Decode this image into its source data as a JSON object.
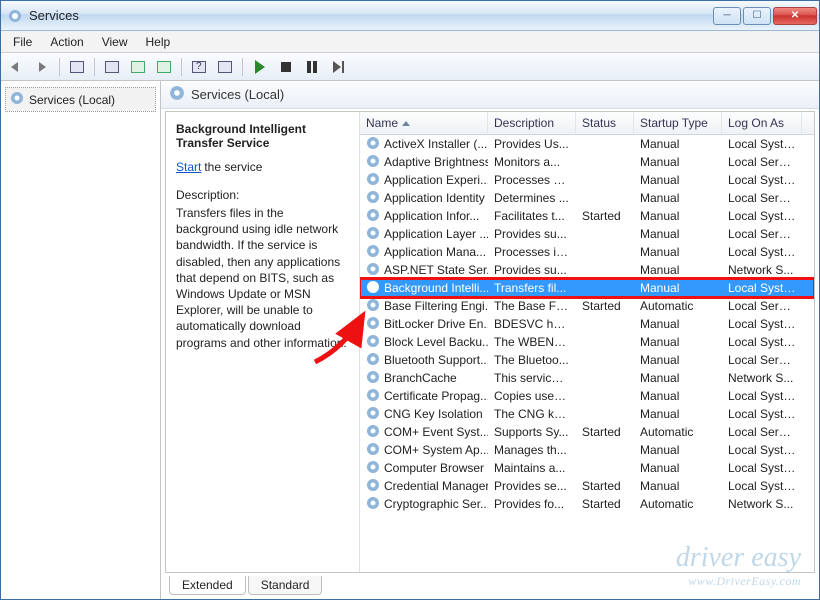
{
  "window": {
    "title": "Services"
  },
  "menubar": {
    "items": [
      "File",
      "Action",
      "View",
      "Help"
    ]
  },
  "toolbar": {
    "buttons": [
      {
        "name": "back-button",
        "icon": "arrow-left-icon"
      },
      {
        "name": "forward-button",
        "icon": "arrow-right-icon"
      },
      {
        "name": "show-hide-tree-button",
        "icon": "panel-icon"
      },
      {
        "name": "properties-button",
        "icon": "props-icon"
      },
      {
        "name": "refresh-button",
        "icon": "refresh-icon"
      },
      {
        "name": "export-list-button",
        "icon": "export-icon"
      },
      {
        "name": "help-button",
        "icon": "help-icon"
      },
      {
        "name": "grid-button",
        "icon": "grid-icon"
      },
      {
        "name": "start-service-button",
        "icon": "play-icon"
      },
      {
        "name": "stop-service-button",
        "icon": "stop-icon"
      },
      {
        "name": "pause-service-button",
        "icon": "pause-icon"
      },
      {
        "name": "restart-service-button",
        "icon": "restart-icon"
      }
    ]
  },
  "tree": {
    "selected_label": "Services (Local)"
  },
  "content_header": "Services (Local)",
  "detail": {
    "title": "Background Intelligent Transfer Service",
    "action_link": "Start",
    "action_text": "the service",
    "desc_label": "Description:",
    "desc_body": "Transfers files in the background using idle network bandwidth. If the service is disabled, then any applications that depend on BITS, such as Windows Update or MSN Explorer, will be unable to automatically download programs and other information."
  },
  "columns": [
    "Name",
    "Description",
    "Status",
    "Startup Type",
    "Log On As"
  ],
  "services": [
    {
      "name": "ActiveX Installer (...",
      "desc": "Provides Us...",
      "status": "",
      "startup": "Manual",
      "logon": "Local Syste..."
    },
    {
      "name": "Adaptive Brightness",
      "desc": "Monitors a...",
      "status": "",
      "startup": "Manual",
      "logon": "Local Service"
    },
    {
      "name": "Application Experi...",
      "desc": "Processes a...",
      "status": "",
      "startup": "Manual",
      "logon": "Local Syste..."
    },
    {
      "name": "Application Identity",
      "desc": "Determines ...",
      "status": "",
      "startup": "Manual",
      "logon": "Local Service"
    },
    {
      "name": "Application Infor...",
      "desc": "Facilitates t...",
      "status": "Started",
      "startup": "Manual",
      "logon": "Local Syste..."
    },
    {
      "name": "Application Layer ...",
      "desc": "Provides su...",
      "status": "",
      "startup": "Manual",
      "logon": "Local Service"
    },
    {
      "name": "Application Mana...",
      "desc": "Processes in...",
      "status": "",
      "startup": "Manual",
      "logon": "Local Syste..."
    },
    {
      "name": "ASP.NET State Ser...",
      "desc": "Provides su...",
      "status": "",
      "startup": "Manual",
      "logon": "Network S..."
    },
    {
      "name": "Background Intelli...",
      "desc": "Transfers fil...",
      "status": "",
      "startup": "Manual",
      "logon": "Local Syste...",
      "selected": true
    },
    {
      "name": "Base Filtering Engi...",
      "desc": "The Base Fil...",
      "status": "Started",
      "startup": "Automatic",
      "logon": "Local Service"
    },
    {
      "name": "BitLocker Drive En...",
      "desc": "BDESVC hos...",
      "status": "",
      "startup": "Manual",
      "logon": "Local Syste..."
    },
    {
      "name": "Block Level Backu...",
      "desc": "The WBENG...",
      "status": "",
      "startup": "Manual",
      "logon": "Local Syste..."
    },
    {
      "name": "Bluetooth Support...",
      "desc": "The Bluetoo...",
      "status": "",
      "startup": "Manual",
      "logon": "Local Service"
    },
    {
      "name": "BranchCache",
      "desc": "This service ...",
      "status": "",
      "startup": "Manual",
      "logon": "Network S..."
    },
    {
      "name": "Certificate Propag...",
      "desc": "Copies user ...",
      "status": "",
      "startup": "Manual",
      "logon": "Local Syste..."
    },
    {
      "name": "CNG Key Isolation",
      "desc": "The CNG ke...",
      "status": "",
      "startup": "Manual",
      "logon": "Local Syste..."
    },
    {
      "name": "COM+ Event Syst...",
      "desc": "Supports Sy...",
      "status": "Started",
      "startup": "Automatic",
      "logon": "Local Service"
    },
    {
      "name": "COM+ System Ap...",
      "desc": "Manages th...",
      "status": "",
      "startup": "Manual",
      "logon": "Local Syste..."
    },
    {
      "name": "Computer Browser",
      "desc": "Maintains a...",
      "status": "",
      "startup": "Manual",
      "logon": "Local Syste..."
    },
    {
      "name": "Credential Manager",
      "desc": "Provides se...",
      "status": "Started",
      "startup": "Manual",
      "logon": "Local Syste..."
    },
    {
      "name": "Cryptographic Ser...",
      "desc": "Provides fo...",
      "status": "Started",
      "startup": "Automatic",
      "logon": "Network S..."
    }
  ],
  "tabs": {
    "extended": "Extended",
    "standard": "Standard",
    "active": "Extended"
  },
  "watermark": {
    "brand": "driver easy",
    "url": "www.DriverEasy.com"
  }
}
